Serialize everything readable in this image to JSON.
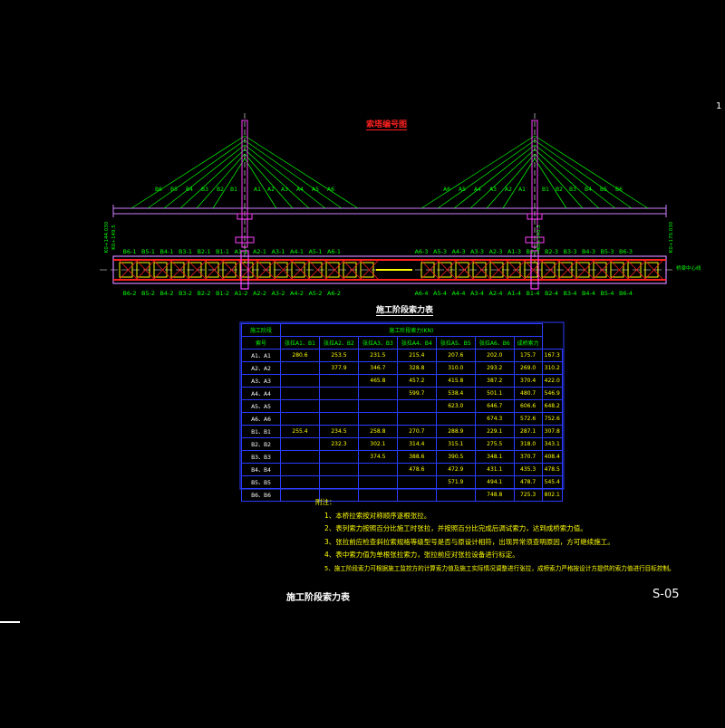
{
  "cable_title": "索塔编号图",
  "table_title": "施工阶段索力表",
  "drawing_title": "施工阶段索力表",
  "drawing_no": "S-05",
  "page_mark": "1",
  "elevation": {
    "left_labels": [
      "B6",
      "B5",
      "B4",
      "B3",
      "B2",
      "B1",
      "A1",
      "A2",
      "A3",
      "A4",
      "A5",
      "A6"
    ],
    "right_labels": [
      "A6",
      "A5",
      "A4",
      "A3",
      "A2",
      "A1",
      "B1",
      "B2",
      "B3",
      "B4",
      "B5",
      "B6"
    ]
  },
  "plan": {
    "top_labels": [
      "B6-1",
      "B5-1",
      "B4-1",
      "B3-1",
      "B2-1",
      "B1-1",
      "A1-1",
      "A2-1",
      "A3-1",
      "A4-1",
      "A5-1",
      "A6-1",
      "A6-3",
      "A5-3",
      "A4-3",
      "A3-3",
      "A2-3",
      "A1-3",
      "B1-3",
      "B2-3",
      "B3-3",
      "B4-3",
      "B5-3",
      "B6-3"
    ],
    "bottom_labels": [
      "B6-2",
      "B5-2",
      "B4-2",
      "B3-2",
      "B2-2",
      "B1-2",
      "A1-2",
      "A2-2",
      "A3-2",
      "A4-2",
      "A5-2",
      "A6-2",
      "A6-4",
      "A5-4",
      "A4-4",
      "A3-4",
      "A2-4",
      "A1-4",
      "B1-4",
      "B2-4",
      "B3-4",
      "B4-4",
      "B5-4",
      "B6-4"
    ],
    "left_side_labels": [
      "K0+144.030",
      "K0+149.5"
    ],
    "right_side_labels": [
      "K0+140.5",
      "K0+170.030"
    ],
    "right_end_label": "桥梁中心线"
  },
  "table": {
    "header_group": "施工阶段索力(KN)",
    "row_header_label": "索号",
    "corner_label": "施工阶段",
    "columns": [
      "张拉A1、B1",
      "张拉A2、B2",
      "张拉A3、B3",
      "张拉A4、B4",
      "张拉A5、B5",
      "张拉A6、B6",
      "成桥索力"
    ],
    "rows": [
      {
        "id": "A1、A1",
        "values": [
          "280.6",
          "253.5",
          "231.5",
          "215.4",
          "207.6",
          "202.0",
          "175.7",
          "167.3"
        ]
      },
      {
        "id": "A2、A2",
        "values": [
          "",
          "377.9",
          "346.7",
          "328.8",
          "310.0",
          "293.2",
          "269.0",
          "310.2"
        ]
      },
      {
        "id": "A3、A3",
        "values": [
          "",
          "",
          "465.8",
          "457.2",
          "415.8",
          "387.2",
          "370.4",
          "422.0"
        ]
      },
      {
        "id": "A4、A4",
        "values": [
          "",
          "",
          "",
          "599.7",
          "538.4",
          "501.1",
          "480.7",
          "546.9"
        ]
      },
      {
        "id": "A5、A5",
        "values": [
          "",
          "",
          "",
          "",
          "623.0",
          "646.7",
          "606.6",
          "648.2"
        ]
      },
      {
        "id": "A6、A6",
        "values": [
          "",
          "",
          "",
          "",
          "",
          "674.3",
          "572.6",
          "752.6"
        ]
      },
      {
        "id": "B1、B1",
        "values": [
          "255.4",
          "234.5",
          "258.8",
          "270.7",
          "288.9",
          "229.1",
          "287.1",
          "307.8"
        ]
      },
      {
        "id": "B2、B2",
        "values": [
          "",
          "232.3",
          "302.1",
          "314.4",
          "315.1",
          "275.5",
          "318.0",
          "343.1"
        ]
      },
      {
        "id": "B3、B3",
        "values": [
          "",
          "",
          "374.5",
          "388.6",
          "390.5",
          "348.1",
          "370.7",
          "408.4"
        ]
      },
      {
        "id": "B4、B4",
        "values": [
          "",
          "",
          "",
          "478.6",
          "472.9",
          "431.1",
          "435.3",
          "478.5"
        ]
      },
      {
        "id": "B5、B5",
        "values": [
          "",
          "",
          "",
          "",
          "571.9",
          "494.1",
          "478.7",
          "545.4"
        ]
      },
      {
        "id": "B6、B6",
        "values": [
          "",
          "",
          "",
          "",
          "",
          "748.8",
          "725.3",
          "802.1"
        ]
      }
    ]
  },
  "notes": {
    "heading": "附注：",
    "items": [
      "1、本桥拉索按对称顺序逐根张拉。",
      "2、表列索力按照百分比施工时张拉，并按照百分比完成后调试索力，达到成桥索力值。",
      "3、张拉前应检查斜拉索规格等级型号是否与原设计相符，出现异常须查明原因，方可继续施工。",
      "4、表中索力值为单根张拉索力，张拉前应对张拉设备进行标定。",
      "5、施工阶段索力可根据施工监控方的计算索力值及施工实际情况调整进行张拉，成桥索力严格按设计方提供的索力值进行目标控制。"
    ]
  },
  "colors": {
    "cable": "#00ff00",
    "tower": "#ff40ff",
    "deck": "#d080ff",
    "girder": "#ffff00",
    "beam": "#ff2020",
    "grid": "#2b3cff"
  }
}
